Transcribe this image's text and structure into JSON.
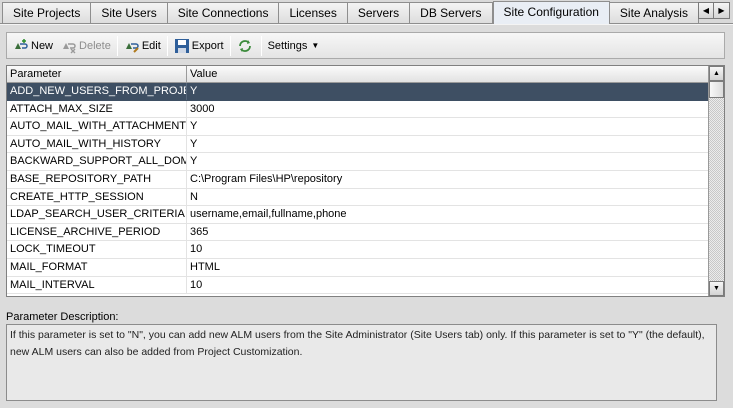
{
  "tabs": [
    {
      "label": "Site Projects",
      "active": false
    },
    {
      "label": "Site Users",
      "active": false
    },
    {
      "label": "Site Connections",
      "active": false
    },
    {
      "label": "Licenses",
      "active": false
    },
    {
      "label": "Servers",
      "active": false
    },
    {
      "label": "DB Servers",
      "active": false
    },
    {
      "label": "Site Configuration",
      "active": true
    },
    {
      "label": "Site Analysis",
      "active": false
    }
  ],
  "toolbar": {
    "new_label": "New",
    "delete_label": "Delete",
    "edit_label": "Edit",
    "export_label": "Export",
    "settings_label": "Settings"
  },
  "table": {
    "headers": {
      "parameter": "Parameter",
      "value": "Value"
    },
    "rows": [
      {
        "parameter": "ADD_NEW_USERS_FROM_PROJECT",
        "value": "Y",
        "selected": true
      },
      {
        "parameter": "ATTACH_MAX_SIZE",
        "value": "3000"
      },
      {
        "parameter": "AUTO_MAIL_WITH_ATTACHMENT",
        "value": "Y"
      },
      {
        "parameter": "AUTO_MAIL_WITH_HISTORY",
        "value": "Y"
      },
      {
        "parameter": "BACKWARD_SUPPORT_ALL_DOMAINS",
        "value": "Y"
      },
      {
        "parameter": "BASE_REPOSITORY_PATH",
        "value": "C:\\Program Files\\HP\\repository"
      },
      {
        "parameter": "CREATE_HTTP_SESSION",
        "value": "N"
      },
      {
        "parameter": "LDAP_SEARCH_USER_CRITERIA",
        "value": "username,email,fullname,phone"
      },
      {
        "parameter": "LICENSE_ARCHIVE_PERIOD",
        "value": "365"
      },
      {
        "parameter": "LOCK_TIMEOUT",
        "value": "10"
      },
      {
        "parameter": "MAIL_FORMAT",
        "value": "HTML"
      },
      {
        "parameter": "MAIL_INTERVAL",
        "value": "10"
      }
    ]
  },
  "description": {
    "label": "Parameter Description:",
    "text": "If this parameter is set to \"N\", you can add new ALM users from the Site Administrator (Site Users tab) only. If this parameter is set to \"Y\" (the default), new ALM users can also be added from Project Customization."
  },
  "colors": {
    "selected_row": "#3e4f63",
    "active_tab": "#e9eef5"
  }
}
